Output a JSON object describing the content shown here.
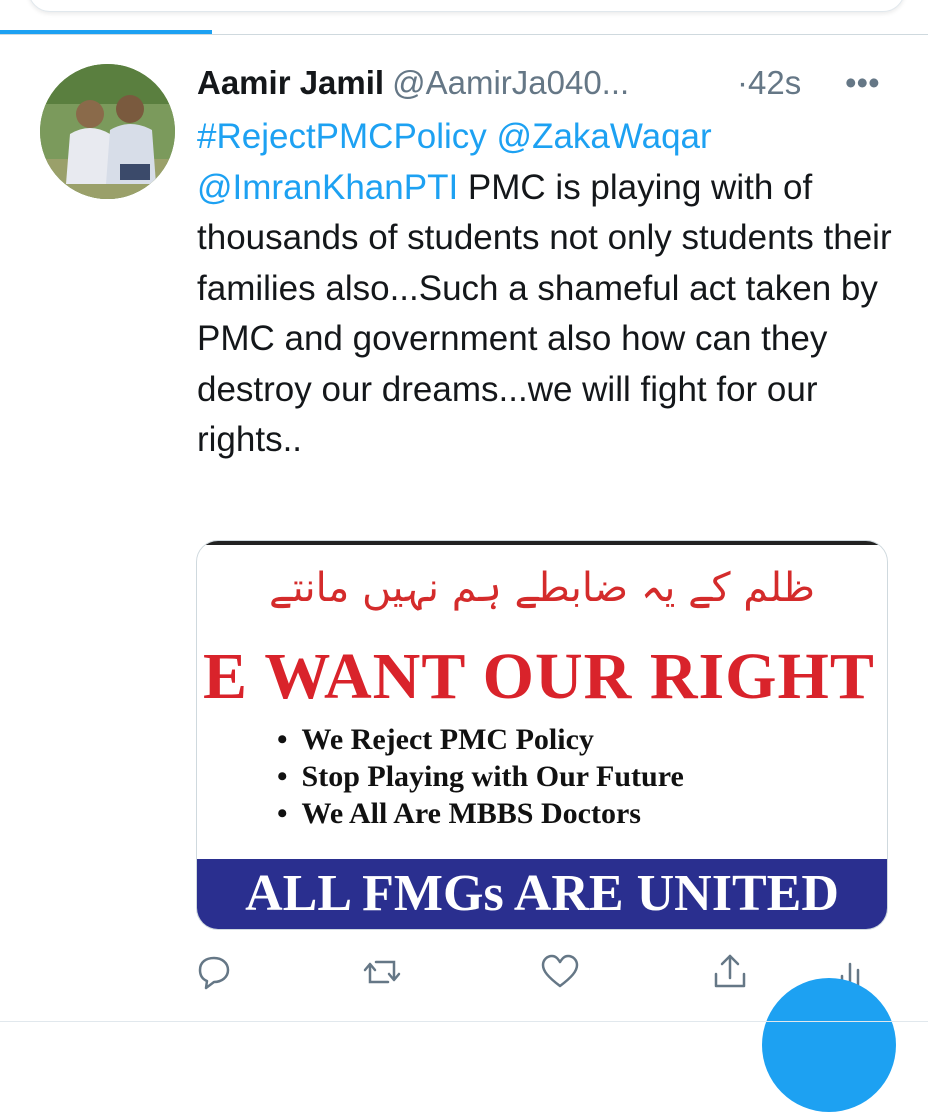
{
  "tweet": {
    "author_name": "Aamir Jamil",
    "author_handle": "@AamirJa040...",
    "time": "·42s",
    "more_icon": "•••",
    "text": {
      "hashtag": "#RejectPMCPolicy",
      "mention1": "@ZakaWaqar",
      "mention2": "@ImranKhanPTI",
      "body": "PMC is playing with of thousands of students not only students their families also...Such a shameful act taken by PMC and government also how can they destroy our dreams...we will fight for our rights.."
    },
    "media": {
      "urdu_line": "ظلم کے یہ ضابطے ہم نہیں مانتے",
      "headline": "E WANT OUR RIGHT",
      "bullets": [
        "We Reject PMC Policy",
        "Stop Playing with Our Future",
        "We All Are MBBS Doctors"
      ],
      "banner": "ALL FMGs ARE UNITED"
    }
  },
  "actions": {
    "reply_icon": "reply-icon",
    "retweet_icon": "retweet-icon",
    "like_icon": "heart-icon",
    "share_icon": "share-icon",
    "analytics_icon": "analytics-icon"
  },
  "colors": {
    "accent": "#1da1f2",
    "secondary_text": "#657786",
    "headline_red": "#d9232b",
    "banner_blue": "#2a2f8f"
  }
}
